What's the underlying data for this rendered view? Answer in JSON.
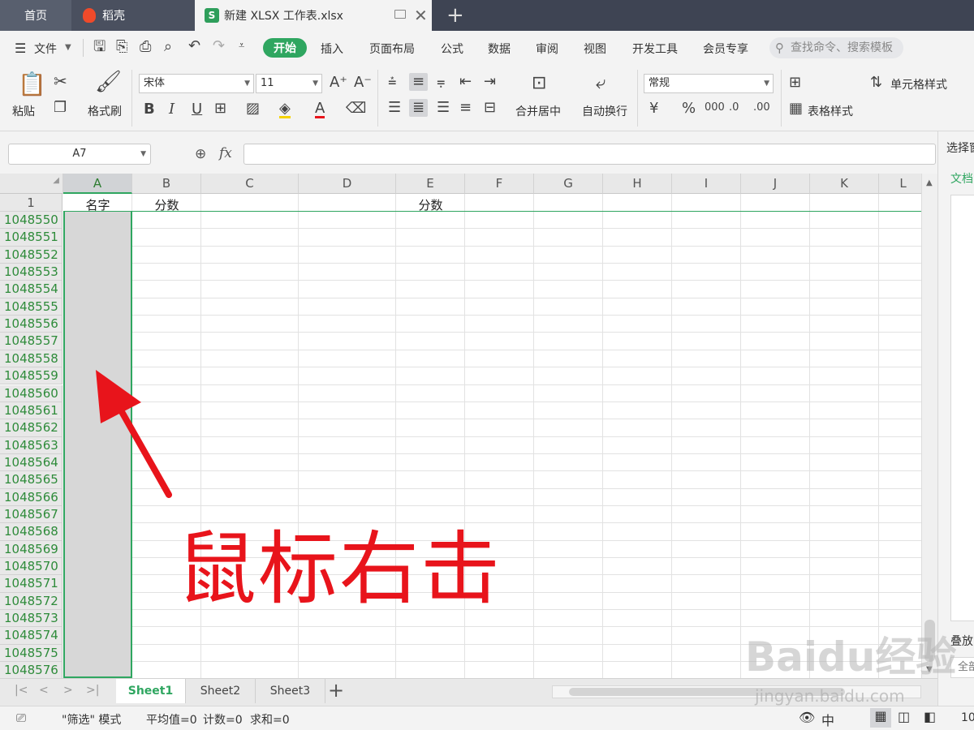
{
  "titlebar": {
    "tabs": [
      {
        "label": "首页"
      },
      {
        "label": "稻壳"
      },
      {
        "label": "新建 XLSX 工作表.xlsx",
        "badge": "S"
      }
    ]
  },
  "menubar": {
    "items": [
      {
        "label": "文件"
      },
      {
        "label": "开始"
      },
      {
        "label": "插入"
      },
      {
        "label": "页面布局"
      },
      {
        "label": "公式"
      },
      {
        "label": "数据"
      },
      {
        "label": "审阅"
      },
      {
        "label": "视图"
      },
      {
        "label": "开发工具"
      },
      {
        "label": "会员专享"
      }
    ],
    "search_placeholder": "查找命令、搜索模板"
  },
  "ribbon": {
    "paste": "粘贴",
    "format_painter": "格式刷",
    "font_name": "宋体",
    "font_size": "11",
    "merge_center": "合并居中",
    "wrap_text": "自动换行",
    "number_format": "常规",
    "cell_style": "单元格样式",
    "table_style": "表格样式"
  },
  "formulabar": {
    "cell_ref": "A7",
    "fx": "fx"
  },
  "grid": {
    "columns": [
      "A",
      "B",
      "C",
      "D",
      "E",
      "F",
      "G",
      "H",
      "I",
      "J",
      "K",
      "L"
    ],
    "row1": {
      "number": "1",
      "A": "名字",
      "B": "分数",
      "E": "分数"
    },
    "rows": [
      "1048550",
      "1048551",
      "1048552",
      "1048553",
      "1048554",
      "1048555",
      "1048556",
      "1048557",
      "1048558",
      "1048559",
      "1048560",
      "1048561",
      "1048562",
      "1048563",
      "1048564",
      "1048565",
      "1048566",
      "1048567",
      "1048568",
      "1048569",
      "1048570",
      "1048571",
      "1048572",
      "1048573",
      "1048574",
      "1048575",
      "1048576"
    ]
  },
  "rightpanel": {
    "title": "选择窗",
    "doc_label": "文档",
    "stack_label": "叠放",
    "all_label": "全部"
  },
  "sheets": [
    "Sheet1",
    "Sheet2",
    "Sheet3"
  ],
  "statusbar": {
    "mode": "\"筛选\" 模式",
    "average": "平均值=0",
    "count": "计数=0",
    "sum": "求和=0",
    "zoom": "10"
  },
  "annotation": "鼠标右击",
  "watermark": {
    "logo": "Baidu经验",
    "url": "jingyan.baidu.com"
  },
  "colors": {
    "accent": "#2fa660",
    "annotation": "#e8141b",
    "titlebar": "#3e4453"
  }
}
